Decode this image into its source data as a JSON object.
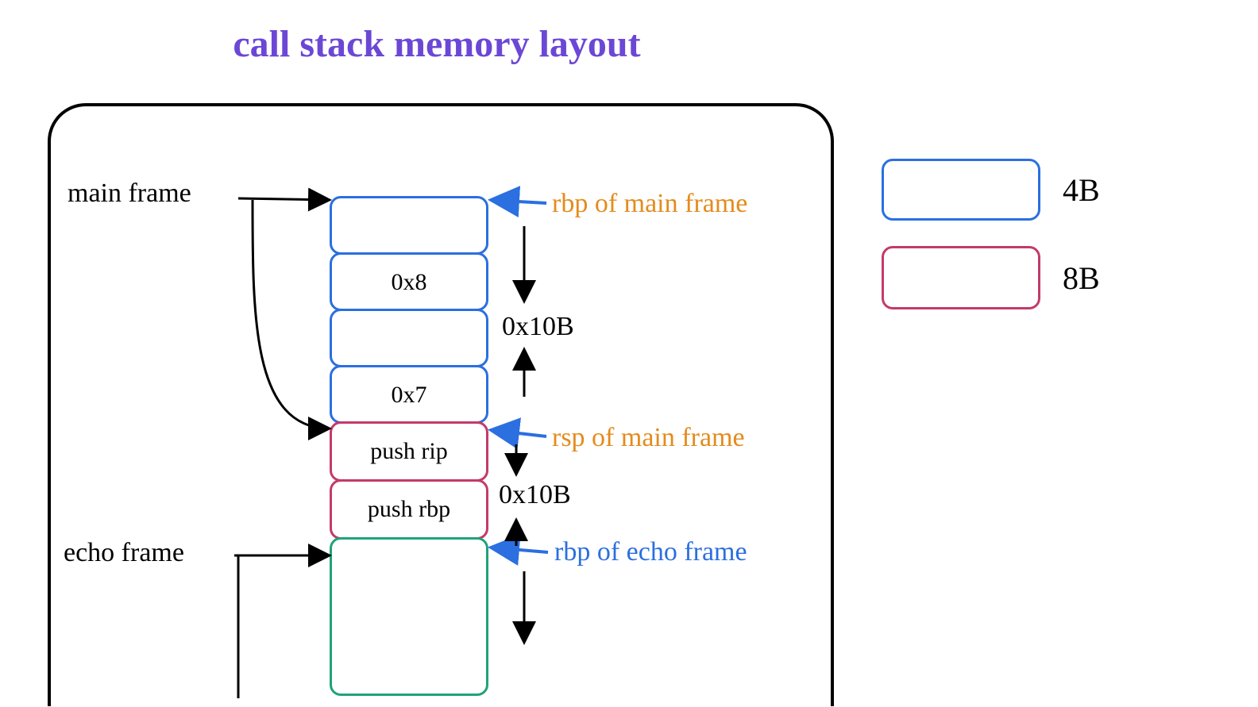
{
  "title": "call stack memory layout",
  "labels": {
    "main_frame": "main frame",
    "echo_frame": "echo frame",
    "rbp_main": "rbp of main frame",
    "rsp_main": "rsp of main frame",
    "rbp_echo": "rbp of echo frame",
    "size1": "0x10B",
    "size2": "0x10B"
  },
  "cells": {
    "c0": "",
    "c1": "0x8",
    "c2": "",
    "c3": "0x7",
    "c4": "push rip",
    "c5": "push rbp"
  },
  "legend": {
    "b4": "4B",
    "b8": "8B"
  }
}
